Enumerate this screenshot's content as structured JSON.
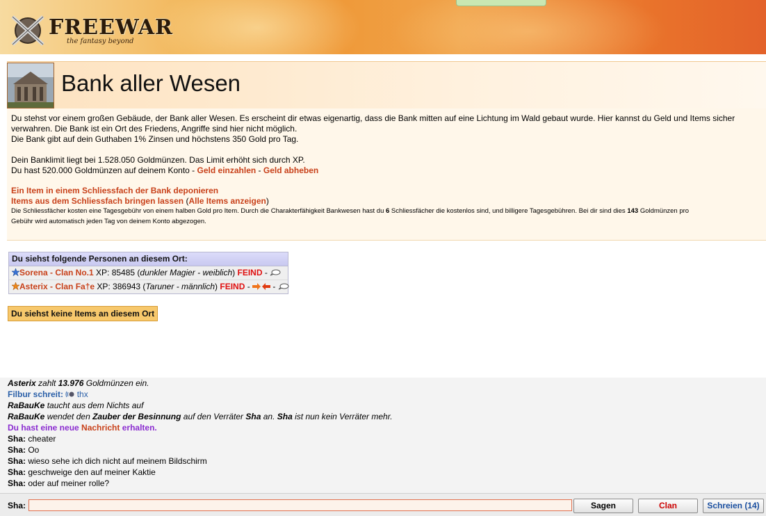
{
  "header": {
    "logo_text": "FREEWAR",
    "logo_subtitle": "the fantasy beyond"
  },
  "location": {
    "title": "Bank aller Wesen",
    "image_icon": "bank-building-image"
  },
  "description": {
    "line1": "Du stehst vor einem großen Gebäude, der Bank aller Wesen. Es erscheint dir etwas eigenartig, dass die Bank mitten auf eine Lichtung im Wald gebaut wurde. Hier kannst du Geld und Items sicher",
    "line2": "verwahren. Die Bank ist ein Ort des Friedens, Angriffe sind hier nicht möglich.",
    "line3": "Die Bank gibt auf dein Guthaben 1% Zinsen und höchstens 350 Gold pro Tag.",
    "limit": "Dein Banklimit liegt bei 1.528.050 Goldmünzen. Das Limit erhöht sich durch XP.",
    "balance": "Du hast 520.000 Goldmünzen auf deinem Konto",
    "deposit_link": "Geld einzahlen",
    "withdraw_link": "Geld abheben",
    "separator": " - ",
    "item_deposit_link": "Ein Item in einem Schliessfach der Bank deponieren",
    "item_retrieve_link": "Items aus dem Schliessfach bringen lassen",
    "all_items_link": "Alle Items anzeigen",
    "small_a": "Die Schliessfächer kosten eine Tagesgebühr von einem halben Gold pro Item. Durch die Charakterfähigkeit Bankwesen hast du ",
    "small_b": "6",
    "small_c": " Schliessfächer die kostenlos sind, und billigere Tagesgebühren. Bei dir sind dies ",
    "small_d": "143",
    "small_e": " Goldmünzen pro",
    "small_f": "Gebühr wird automatisch jeden Tag von deinem Konto abgezogen."
  },
  "persons": {
    "header": "Du siehst folgende Personen an diesem Ort:",
    "rows": [
      {
        "name": "Sorena - Clan No.1",
        "xp_label": " XP: 85485 (",
        "desc": "dunkler Magier - weiblich",
        "close": ") ",
        "status": "FEIND",
        "tail": " - ",
        "star_color": "#3a74d8"
      },
      {
        "name": "Asterix - Clan Fa†e",
        "xp_label": " XP: 386943 (",
        "desc": "Taruner - männlich",
        "close": ") ",
        "status": "FEIND",
        "tail": " - ",
        "star_color": "#f08a1a"
      }
    ]
  },
  "items_button": "Du siehst keine Items an diesem Ort",
  "chat": {
    "l1_name": "Asterix",
    "l1_a": " zahlt ",
    "l1_b": "13.976",
    "l1_c": " Goldmünzen ein.",
    "l2_a": "Filbur schreit:",
    "l2_b": " thx",
    "l3_name": "RaBauKe",
    "l3_a": " taucht aus dem Nichts auf",
    "l4_name": "RaBauKe",
    "l4_a": " wendet den ",
    "l4_b": "Zauber der Besinnung",
    "l4_c": " auf den Verräter ",
    "l4_d": "Sha",
    "l4_e": " an. ",
    "l4_f": "Sha",
    "l4_g": " ist nun kein Verräter mehr.",
    "l5_a": "Du hast eine neue ",
    "l5_b": "Nachricht",
    "l5_c": " erhalten.",
    "messages": [
      {
        "who": "Sha:",
        "text": " cheater"
      },
      {
        "who": "Sha:",
        "text": " Oo"
      },
      {
        "who": "Sha:",
        "text": " wieso sehe ich dich nicht auf meinem Bildschirm"
      },
      {
        "who": "Sha:",
        "text": " geschweige den auf meiner Kaktie"
      },
      {
        "who": "Sha:",
        "text": " oder auf meiner rolle?"
      }
    ]
  },
  "input_bar": {
    "label": "Sha:",
    "value": "",
    "sagen": "Sagen",
    "clan": "Clan",
    "schreien": "Schreien (14)"
  }
}
